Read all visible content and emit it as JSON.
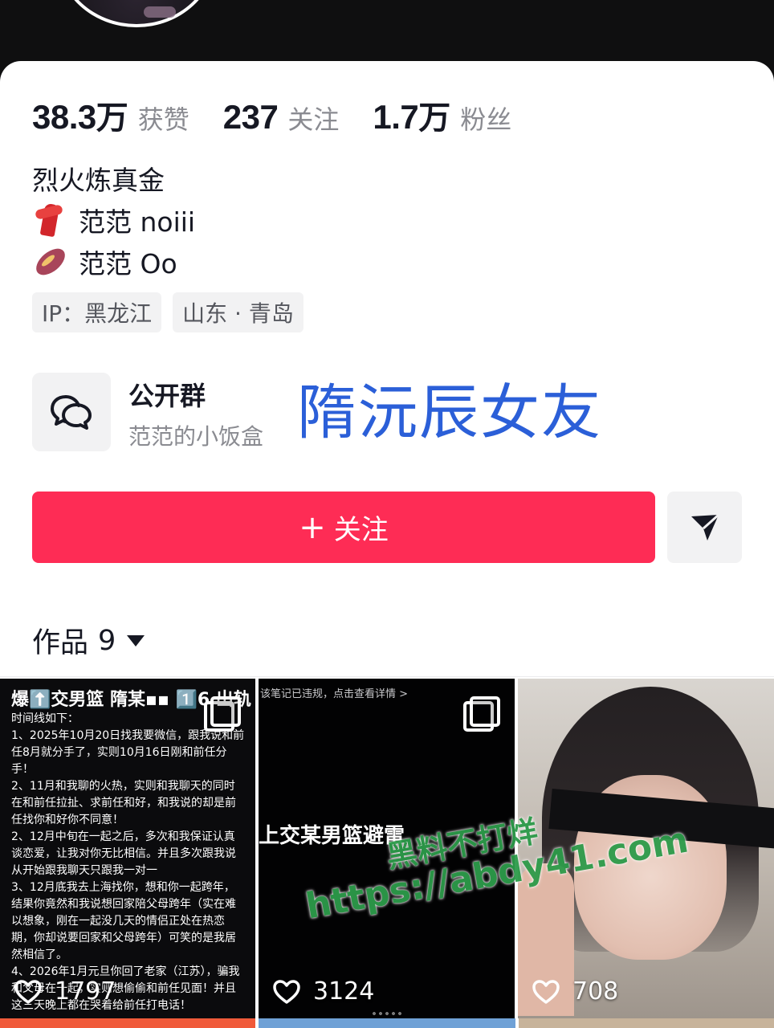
{
  "stats": [
    {
      "num": "38.3",
      "unit": "万",
      "label": "获赞"
    },
    {
      "num": "237",
      "unit": "",
      "label": "关注"
    },
    {
      "num": "1.7",
      "unit": "万",
      "label": "粉丝"
    }
  ],
  "bio": {
    "line1": "烈火炼真金",
    "line2_icon": "scarf-icon",
    "line2": "范范 noiii",
    "line3_icon": "sweet-potato-icon",
    "line3": "范范 Oo"
  },
  "tags": [
    "IP：黑龙江",
    "山东 · 青岛"
  ],
  "group": {
    "icon": "chat-bubbles-icon",
    "title": "公开群",
    "subtitle": "范范的小饭盒"
  },
  "overlay_text": "隋沅辰女友",
  "follow_button": {
    "plus": "+",
    "label": "关注"
  },
  "send_button_icon": "send-icon",
  "works": {
    "label": "作品",
    "count": "9"
  },
  "tiles": [
    {
      "head": "爆⬆️交男篮 隋某▪▪ 1️⃣6 出轨",
      "lines": [
        "时间线如下：",
        "1、2025年10月20日找我要微信，跟我说和前任8月就分手了，实则10月16日刚和前任分手！",
        "2、11月和我聊的火热，实则和我聊天的同时在和前任拉扯、求前任和好，和我说的却是前任找你和好你不同意！",
        "2、12月中旬在一起之后，多次和我保证认真谈恋爱，让我对你无比相信。并且多次跟我说从开始跟我聊天只跟我一对一",
        "3、12月底我去上海找你，想和你一起跨年，结果你竟然和我说想回家陪父母跨年（实在难以想象，刚在一起没几天的情侣正处在热恋期，你却说要回家和父母跨年）可笑的是我居然相信了。",
        "4、2026年1月元旦你回了老家（江苏），骗我和父母在一起，实则想偷偷和前任见面！并且这三天晚上都在哭着给前任打电话！"
      ],
      "likes": "1797"
    },
    {
      "notice": "该笔记已违规，点击查看详情 >",
      "title": "上交某男篮避雷",
      "likes": "3124"
    },
    {
      "likes": "708"
    }
  ],
  "watermark": {
    "line1": "黑料不打烊",
    "line2": "https://abdy41.com"
  }
}
